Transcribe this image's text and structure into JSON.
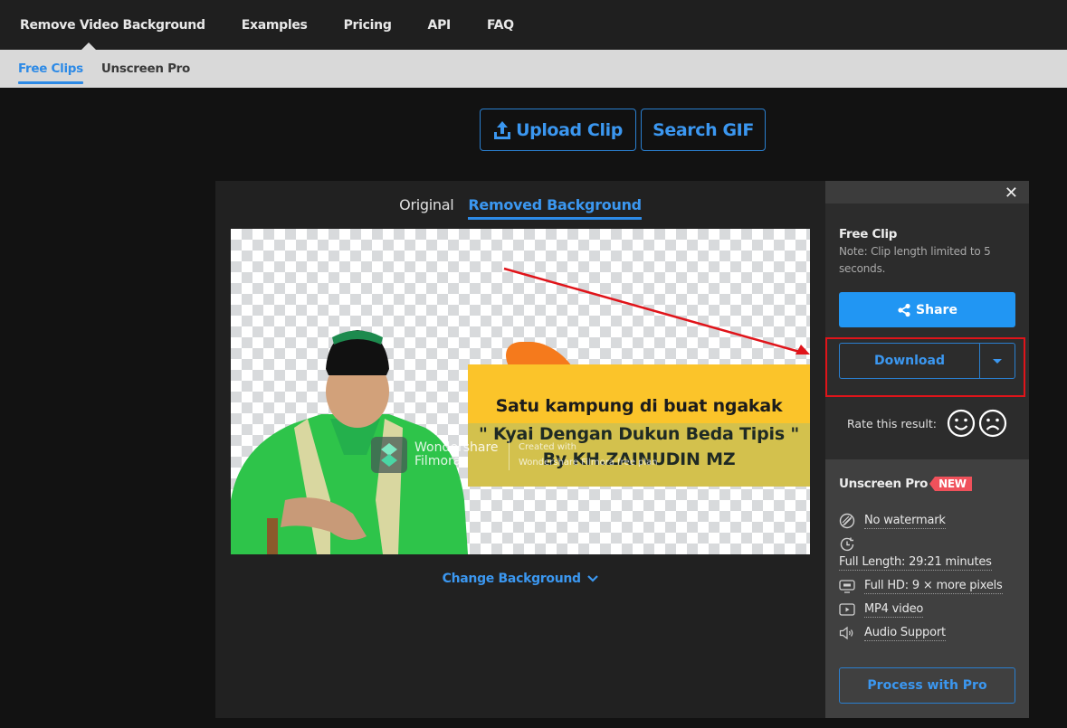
{
  "topnav": {
    "items": [
      "Remove Video Background",
      "Examples",
      "Pricing",
      "API",
      "FAQ"
    ]
  },
  "subnav": {
    "items": [
      "Free Clips",
      "Unscreen Pro"
    ],
    "active": "Free Clips"
  },
  "actions": {
    "upload_label": "Upload Clip",
    "search_label": "Search GIF"
  },
  "preview": {
    "tabs": [
      "Original",
      "Removed Background"
    ],
    "active_tab": "Removed Background",
    "video_overlay": {
      "line1": "Satu kampung di buat ngakak",
      "line2": "\" Kyai Dengan Dukun Beda Tipis \"",
      "line3": "By KH.ZAINUDIN MZ",
      "watermark_brand": "Wondershare Filmora",
      "watermark_created": "Created with",
      "watermark_plan": "Wondershare Filmora free plan"
    },
    "change_background_label": "Change Background"
  },
  "sidebar": {
    "close_icon": "close-icon",
    "free_title": "Free Clip",
    "free_note": "Note: Clip length limited to 5 seconds.",
    "share_label": "Share",
    "download_label": "Download",
    "rate_label": "Rate this result:",
    "pro": {
      "title": "Unscreen Pro",
      "badge": "NEW",
      "features": [
        {
          "icon": "no-watermark-icon",
          "label": "No watermark"
        },
        {
          "icon": "clock-icon",
          "label": "Full Length: 29:21 minutes"
        },
        {
          "icon": "hd-screen-icon",
          "label": "Full HD: 9 × more pixels"
        },
        {
          "icon": "play-icon",
          "label": "MP4 video"
        },
        {
          "icon": "speaker-icon",
          "label": "Audio Support"
        }
      ],
      "process_label": "Process with Pro"
    }
  },
  "colors": {
    "accent": "#2d8ae6",
    "share_button": "#2196f3",
    "highlight": "#e0141a",
    "new_badge": "#f0515b"
  }
}
